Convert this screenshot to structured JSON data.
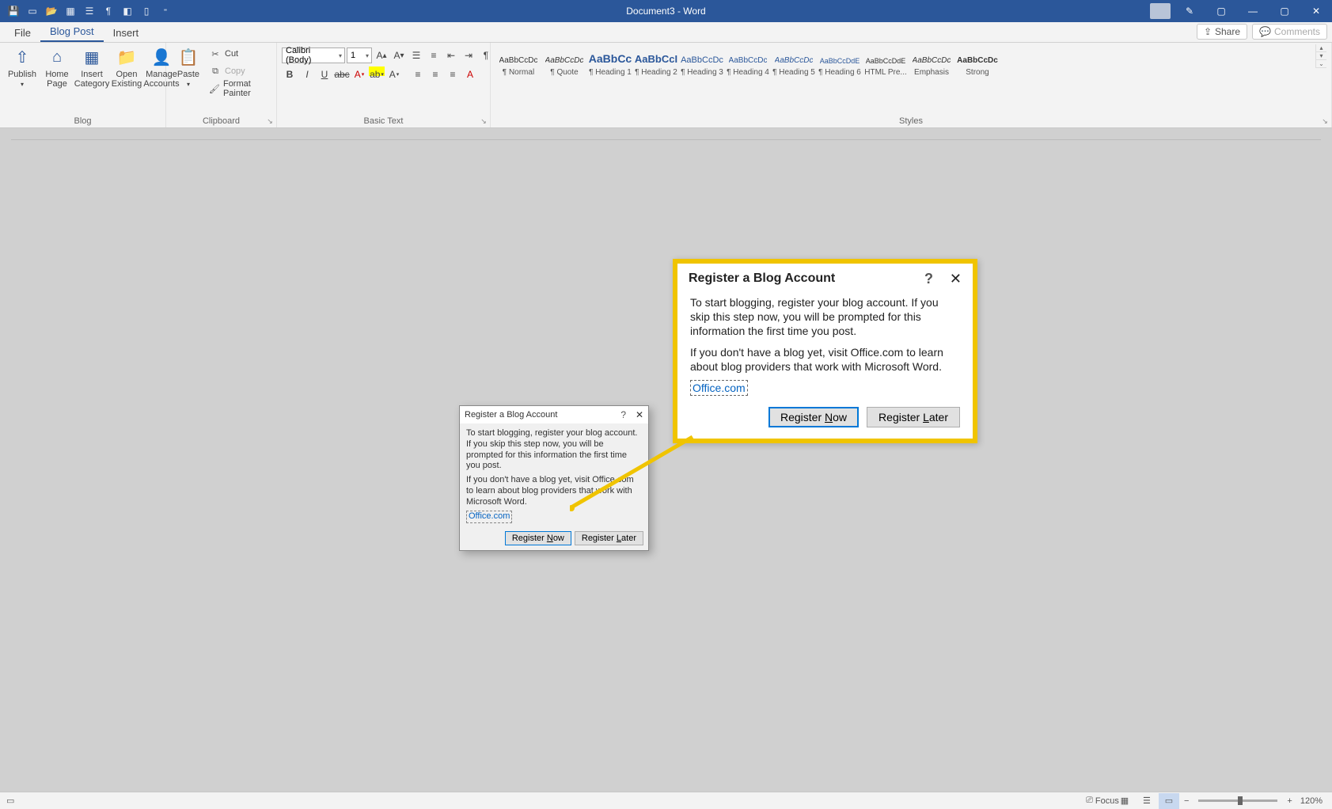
{
  "titlebar": {
    "title": "Document3 - Word"
  },
  "tabs": {
    "file": "File",
    "blogpost": "Blog Post",
    "insert": "Insert",
    "share": "Share",
    "comments": "Comments"
  },
  "ribbon": {
    "blog": {
      "label": "Blog",
      "publish": "Publish",
      "home": "Home\nPage",
      "insertcat": "Insert\nCategory",
      "openexist": "Open\nExisting",
      "manage": "Manage\nAccounts"
    },
    "clipboard": {
      "label": "Clipboard",
      "paste": "Paste",
      "cut": "Cut",
      "copy": "Copy",
      "format": "Format Painter"
    },
    "basictext": {
      "label": "Basic Text",
      "font": "Calibri (Body)",
      "size": "1"
    },
    "styles": {
      "label": "Styles",
      "items": [
        {
          "preview": "AaBbCcDc",
          "name": "¶ Normal",
          "size": "10px",
          "color": "#333"
        },
        {
          "preview": "AaBbCcDc",
          "name": "¶ Quote",
          "size": "10px",
          "color": "#333",
          "italic": true
        },
        {
          "preview": "AaBbCc",
          "name": "¶ Heading 1",
          "size": "14px",
          "color": "#2b579a",
          "bold": true
        },
        {
          "preview": "AaBbCcI",
          "name": "¶ Heading 2",
          "size": "13px",
          "color": "#2b579a",
          "bold": true
        },
        {
          "preview": "AaBbCcDc",
          "name": "¶ Heading 3",
          "size": "11px",
          "color": "#2b579a"
        },
        {
          "preview": "AaBbCcDc",
          "name": "¶ Heading 4",
          "size": "10px",
          "color": "#2b579a"
        },
        {
          "preview": "AaBbCcDc",
          "name": "¶ Heading 5",
          "size": "10px",
          "color": "#2b579a",
          "italic": true
        },
        {
          "preview": "AaBbCcDdE",
          "name": "¶ Heading 6",
          "size": "9px",
          "color": "#2b579a"
        },
        {
          "preview": "AaBbCcDdE",
          "name": "HTML Pre...",
          "size": "9px",
          "color": "#333"
        },
        {
          "preview": "AaBbCcDc",
          "name": "Emphasis",
          "size": "10px",
          "color": "#333",
          "italic": true
        },
        {
          "preview": "AaBbCcDc",
          "name": "Strong",
          "size": "10px",
          "color": "#333",
          "bold": true
        }
      ]
    }
  },
  "dialog": {
    "title": "Register a Blog Account",
    "p1": "To start blogging, register your blog account. If you skip this step now, you will be prompted for this information the first time you post.",
    "p2": "If you don't have a blog yet, visit Office.com to learn about blog providers that work with Microsoft Word.",
    "link": "Office.com",
    "btn_now_pre": "Register ",
    "btn_now_u": "N",
    "btn_now_post": "ow",
    "btn_later_pre": "Register ",
    "btn_later_u": "L",
    "btn_later_post": "ater"
  },
  "statusbar": {
    "focus": "Focus",
    "zoom": "120%"
  }
}
